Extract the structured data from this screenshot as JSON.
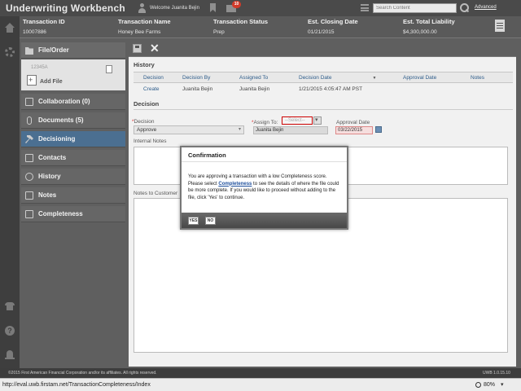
{
  "app": {
    "title": "Underwriting Workbench",
    "welcome": "Welcome Juanita Bejin",
    "mail_count": "10",
    "search_placeholder": "Search Content",
    "advanced_label": "Advanced"
  },
  "transaction": {
    "columns": [
      {
        "label": "Transaction ID",
        "value": "10007886"
      },
      {
        "label": "Transaction Name",
        "value": "Honey Bee Farms"
      },
      {
        "label": "Transaction Status",
        "value": "Prep"
      },
      {
        "label": "Est. Closing Date",
        "value": "01/21/2015"
      },
      {
        "label": "Est. Total Liability",
        "value": "$4,300,000.00"
      }
    ]
  },
  "nav": {
    "file_order": "File/Order",
    "file_number": "12345A",
    "add_file": "Add File",
    "items": [
      {
        "label": "Collaboration (0)",
        "icon": "collaboration-icon"
      },
      {
        "label": "Documents (5)",
        "icon": "paperclip-icon"
      },
      {
        "label": "Decisioning",
        "icon": "gavel-icon"
      },
      {
        "label": "Contacts",
        "icon": "contacts-icon"
      },
      {
        "label": "History",
        "icon": "clock-icon"
      },
      {
        "label": "Notes",
        "icon": "notes-icon"
      },
      {
        "label": "Completeness",
        "icon": "checklist-icon"
      }
    ]
  },
  "history": {
    "title": "History",
    "headers": [
      "Decision",
      "Decision By",
      "Assigned To",
      "Decision Date",
      "Approval Date",
      "Notes"
    ],
    "rows": [
      {
        "decision": "Create",
        "decision_by": "Juanita Bejin",
        "assigned_to": "Juanita Bejin",
        "decision_date": "1/21/2015 4:05:47 AM PST",
        "approval_date": "",
        "notes": ""
      }
    ]
  },
  "decision": {
    "title": "Decision",
    "decision_label": "Decision",
    "decision_value": "Approve",
    "assign_label": "Assign To:",
    "assign_placeholder": "--Select--",
    "assign_value": "Juanita Bejin",
    "approval_date_label": "Approval Date",
    "approval_date_value": "03/22/2015",
    "internal_notes_label": "Internal Notes",
    "customer_notes_label": "Notes to Customer"
  },
  "dialog": {
    "title": "Confirmation",
    "text_before": "You are approving a transaction with a low Completeness score. Please select ",
    "link_text": "Completeness",
    "text_after": " to see the details of where the file could be more complete. If you would like to proceed without adding to the file, click 'Yes' to continue.",
    "yes_label": "YES",
    "no_label": "NO"
  },
  "footer": {
    "copyright": "©2015 First American Financial Corporation and/or its affiliates. All rights reserved.",
    "version": "UWB 1.0.15.10"
  },
  "statusbar": {
    "url": "http://eval.uwb.firstam.net/TransactionCompleteness/Index",
    "zoom": "80%"
  },
  "colors": {
    "active_nav": "#4b6f91",
    "link": "#1e4f9c",
    "badge": "#d23b2a"
  }
}
